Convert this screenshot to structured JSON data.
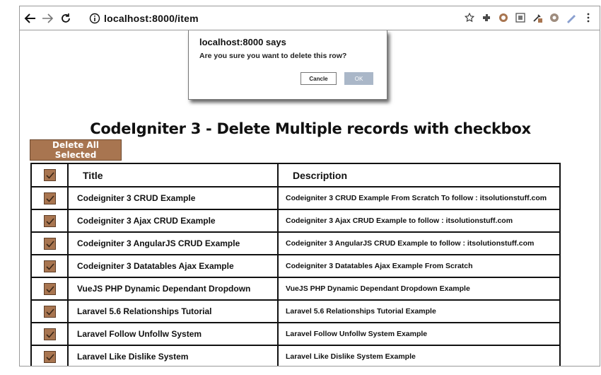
{
  "browser": {
    "url": "localhost:8000/item",
    "icons": [
      "back-icon",
      "forward-icon",
      "reload-icon",
      "info-icon",
      "star-icon",
      "extension-icons",
      "menu-icon"
    ]
  },
  "dialog": {
    "title": "localhost:8000 says",
    "message": "Are you sure you want to delete this row?",
    "cancel_label": "Cancle",
    "ok_label": "OK"
  },
  "page": {
    "title": "CodeIgniter 3 - Delete Multiple records with checkbox",
    "delete_all_label": "Delete All Selected"
  },
  "table": {
    "headers": {
      "title": "Title",
      "description": "Description"
    },
    "rows": [
      {
        "title": "Codeigniter 3 CRUD Example",
        "description": "Codeigniter 3 CRUD Example From Scratch To follow : itsolutionstuff.com",
        "checked": true
      },
      {
        "title": "Codeigniter 3 Ajax CRUD Example",
        "description": "Codeigniter 3 Ajax CRUD Example to follow : itsolutionstuff.com",
        "checked": true
      },
      {
        "title": "Codeigniter 3 AngularJS CRUD Example",
        "description": "Codeigniter 3 AngularJS CRUD Example to follow : itsolutionstuff.com",
        "checked": true
      },
      {
        "title": "Codeigniter 3 Datatables Ajax Example",
        "description": "Codeigniter 3 Datatables Ajax Example From Scratch",
        "checked": true
      },
      {
        "title": "VueJS PHP Dynamic Dependant Dropdown",
        "description": "VueJS PHP Dynamic Dependant Dropdown Example",
        "checked": true
      },
      {
        "title": "Laravel 5.6 Relationships Tutorial",
        "description": "Laravel 5.6 Relationships Tutorial Example",
        "checked": true
      },
      {
        "title": "Laravel Follow Unfollw System",
        "description": "Laravel Follow Unfollw System Example",
        "checked": true
      },
      {
        "title": "Laravel Like Dislike System",
        "description": "Laravel Like Dislike System Example",
        "checked": true
      }
    ]
  },
  "colors": {
    "accent": "#a87550",
    "ok_button": "#aab7c8"
  }
}
